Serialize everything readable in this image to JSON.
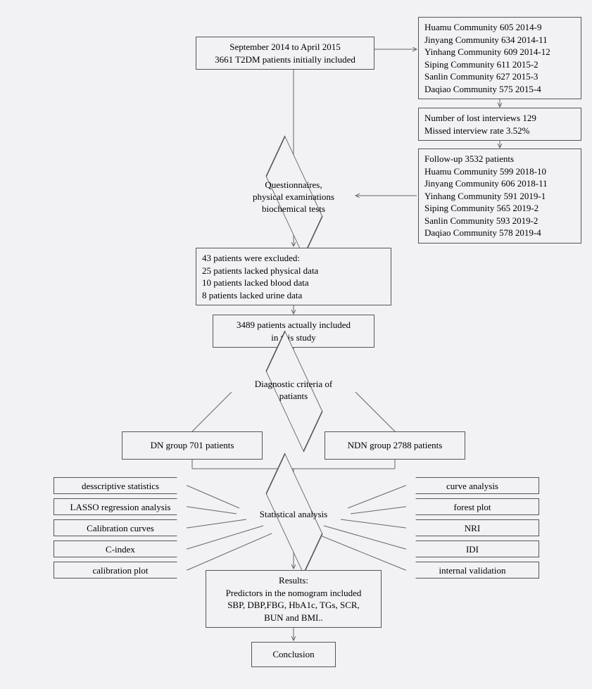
{
  "box_top": {
    "l1": "September 2014 to April 2015",
    "l2": "3661 T2DM patients initially included"
  },
  "side1": {
    "l1": "Huamu Community 605 2014-9",
    "l2": "Jinyang Community 634 2014-11",
    "l3": "Yinhang Community 609 2014-12",
    "l4": "Siping Community 611 2015-2",
    "l5": "Sanlin Community 627 2015-3",
    "l6": "Daqiao Community 575 2015-4"
  },
  "lost": {
    "l1": "Number of lost interviews 129",
    "l2": "Missed interview rate 3.52%"
  },
  "side2": {
    "l1": "Follow-up 3532 patients",
    "l2": "Huamu Community 599 2018-10",
    "l3": "Jinyang Community 606 2018-11",
    "l4": "Yinhang Community 591 2019-1",
    "l5": "Siping Community 565 2019-2",
    "l6": "Sanlin Community 593 2019-2",
    "l7": "Daqiao Community 578 2019-4"
  },
  "d1": {
    "l1": "Questionnaires,",
    "l2": "physical examinations",
    "l3": "biochemical tests"
  },
  "excl": {
    "l1": "43 patients were excluded:",
    "l2": "25 patients lacked physical data",
    "l3": "10 patients lacked blood data",
    "l4": "8 patients lacked urine data"
  },
  "incl": {
    "l1": "3489 patients actually included",
    "l2": "in this study"
  },
  "d2": {
    "l1": "Diagnostic criteria of",
    "l2": "patiants"
  },
  "dn": "DN group  701 patients",
  "ndn": "NDN group 2788 patients",
  "d3": "Statistical analysis",
  "left_tags": {
    "a": "desscriptive statistics",
    "b": "LASSO regression analysis",
    "c": "Calibration curves",
    "d": "C-index",
    "e": "calibration plot"
  },
  "right_tags": {
    "a": "curve analysis",
    "b": "forest plot",
    "c": "NRI",
    "d": "IDI",
    "e": "internal validation"
  },
  "results": {
    "l1": "Results:",
    "l2": "Predictors in the nomogram included",
    "l3": "SBP, DBP,FBG, HbA1c, TGs, SCR,",
    "l4": "BUN and BMI.."
  },
  "conclusion": "Conclusion"
}
